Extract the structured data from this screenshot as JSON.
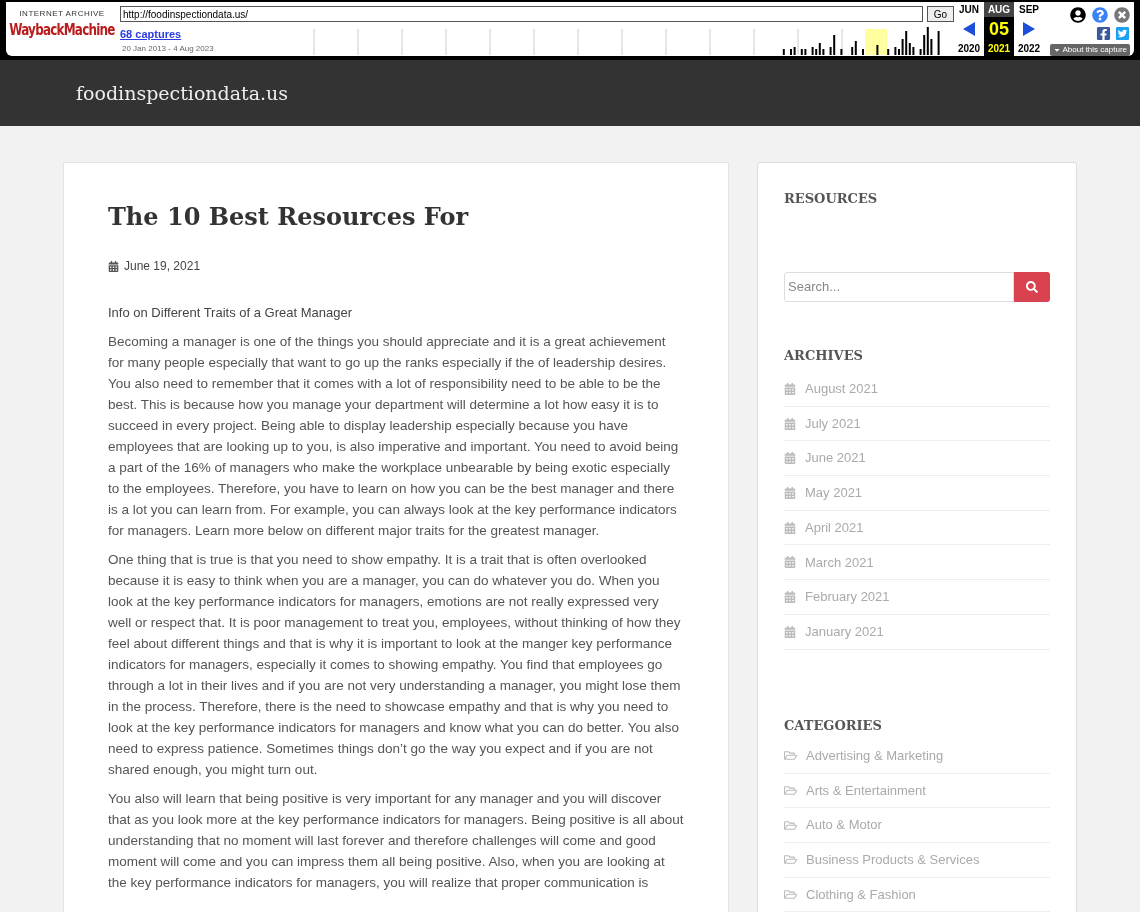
{
  "wayback": {
    "brand_top": "INTERNET ARCHIVE",
    "brand_logo": "WaybackMachine",
    "url": "http://foodinspectiondata.us/",
    "go": "Go",
    "captures": "68 captures",
    "range": "20 Jan 2013 - 4 Aug 2023",
    "months": [
      {
        "month": "JUN",
        "year": "2020",
        "selected": false
      },
      {
        "month": "AUG",
        "day": "05",
        "year": "2021",
        "selected": true
      },
      {
        "month": "SEP",
        "year": "2022",
        "selected": false
      }
    ],
    "about": "About this capture"
  },
  "site": {
    "title": "foodinspectiondata.us"
  },
  "post": {
    "title": "The 10 Best Resources For",
    "date": "June 19, 2021",
    "subtitle": "Info on Different Traits of a Great Manager",
    "paragraphs": [
      "Becoming a manager is one of the things you should appreciate and it is a great achievement for many people especially that want to go up the ranks especially if the of leadership desires. You also need to remember that it comes with a lot of responsibility need to be able to be the best. This is because how you manage your department will determine a lot how easy it is to succeed in every project. Being able to display leadership especially because you have employees that are looking up to you, is also imperative and important. You need to avoid being a part of the 16% of managers who make the workplace unbearable by being exotic especially to the employees. Therefore, you have to learn on how you can be the best manager and there is a lot you can learn from. For example, you can always look at the key performance indicators for managers. Learn more below on different major traits for the greatest manager.",
      "One thing that is true is that you need to show empathy. It is a trait that is often overlooked because it is easy to think when you are a manager, you can do whatever you do. When you look at the key performance indicators for managers, emotions are not really expressed very well or respect that. It is poor management to treat you, employees, without thinking of how they feel about different things and that is why it is important to look at the manger key performance indicators for managers, especially it comes to showing empathy. You find that employees go through a lot in their lives and if you are not very understanding a manager, you might lose them in the process. Therefore, there is the need to showcase empathy and that is why you need to look at the key performance indicators for managers and know what you can do better. You also need to express patience. Sometimes things don’t go the way you expect and if you are not shared enough, you might turn out.",
      "You also will learn that being positive is very important for any manager and you will discover that as you look more at the key performance indicators for managers. Being positive is all about understanding that no moment will last forever and therefore challenges will come and good moment will come and you can impress them all being positive. Also, when you are looking at the key performance indicators for managers, you will realize that proper communication is"
    ]
  },
  "sidebar": {
    "resources_title": "RESOURCES",
    "search": {
      "placeholder": "Search..."
    },
    "archives_title": "ARCHIVES",
    "archives": [
      "August 2021",
      "July 2021",
      "June 2021",
      "May 2021",
      "April 2021",
      "March 2021",
      "February 2021",
      "January 2021"
    ],
    "categories_title": "CATEGORIES",
    "categories": [
      "Advertising & Marketing",
      "Arts & Entertainment",
      "Auto & Motor",
      "Business Products & Services",
      "Clothing & Fashion"
    ]
  }
}
